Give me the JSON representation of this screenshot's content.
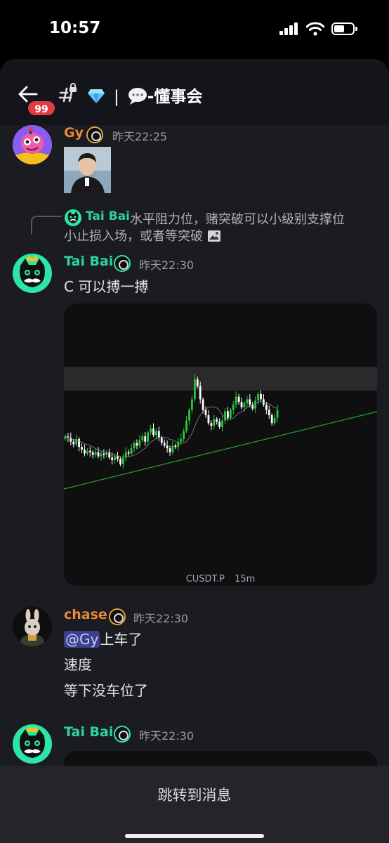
{
  "status_bar": {
    "time": "10:57"
  },
  "header": {
    "unread_badge": "99",
    "channel_separator": "|",
    "channel_name": "-懂事会"
  },
  "messages": [
    {
      "user": "Gy",
      "user_color": "#e8873a",
      "time": "昨天22:25",
      "attachment": "photo"
    },
    {
      "reply": {
        "user": "Tai Bai",
        "text_line1": "水平阻力位，赌突破可以小级别支撑位",
        "text_line2": "小止损入场，或者等突破"
      },
      "user": "Tai Bai",
      "user_color": "#2ed4a0",
      "time": "昨天22:30",
      "text": "C 可以搏一搏",
      "chart": {
        "symbol": "CUSDT.P",
        "interval": "15m"
      }
    },
    {
      "user": "chase",
      "user_color": "#e8873a",
      "time": "昨天22:30",
      "mention": "@Gy",
      "line1_rest": "上车了",
      "line2": "速度",
      "line3": "等下没车位了"
    },
    {
      "user": "Tai Bai",
      "user_color": "#2ed4a0",
      "time": "昨天22:30"
    }
  ],
  "jump_bar": {
    "label": "跳转到消息"
  },
  "chart_data": {
    "type": "candlestick",
    "title": "",
    "symbol": "CUSDT.P",
    "interval": "15m",
    "colors": {
      "up": "#27c93f",
      "down": "#ffffff",
      "trendline": "#22a52a",
      "resistance_zone": "#2a2a2b"
    },
    "closes": [
      0.62,
      0.61,
      0.58,
      0.56,
      0.6,
      0.54,
      0.52,
      0.49,
      0.51,
      0.5,
      0.48,
      0.5,
      0.47,
      0.49,
      0.48,
      0.5,
      0.46,
      0.44,
      0.47,
      0.45,
      0.41,
      0.46,
      0.5,
      0.49,
      0.53,
      0.57,
      0.55,
      0.59,
      0.62,
      0.58,
      0.65,
      0.68,
      0.63,
      0.66,
      0.61,
      0.57,
      0.55,
      0.53,
      0.5,
      0.55,
      0.54,
      0.58,
      0.6,
      0.66,
      0.74,
      0.82,
      0.9,
      1.05,
      1.0,
      0.9,
      0.82,
      0.78,
      0.72,
      0.7,
      0.75,
      0.73,
      0.69,
      0.74,
      0.81,
      0.76,
      0.82,
      0.86,
      0.92,
      0.88,
      0.84,
      0.87,
      0.9,
      0.86,
      0.83,
      0.89,
      0.94,
      0.9,
      0.86,
      0.82,
      0.78,
      0.72,
      0.76,
      0.82
    ]
  }
}
